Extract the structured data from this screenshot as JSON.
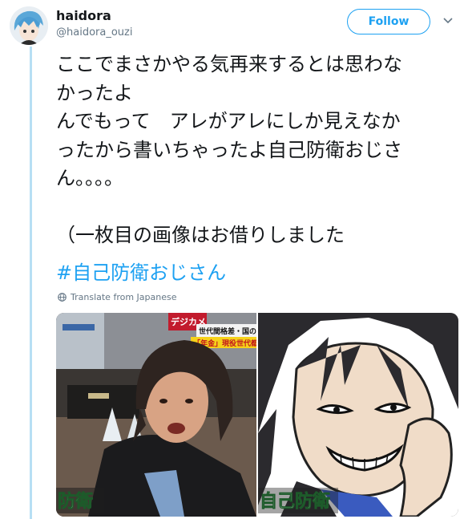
{
  "user": {
    "display_name": "haidora",
    "handle": "@haidora_ouzi"
  },
  "follow_label": "Follow",
  "tweet": {
    "lines": [
      "ここでまさかやる気再来するとは思わな",
      "かったよ",
      "んでもって　アレがアレにしか見えなか",
      "ったから書いちゃったよ自己防衛おじさ",
      "ん。。。。",
      "",
      "（一枚目の画像はお借りしました"
    ],
    "hashtag": "#自己防衛おじさん"
  },
  "translate_label": "Translate from Japanese",
  "media": {
    "left_image": {
      "sign_top": "デジカメ",
      "banner_line1": "世代間格差・国の借",
      "banner_line2": "「年金」現役世代都",
      "caption": "防衛"
    },
    "right_image": {
      "caption": "自己防衛"
    }
  },
  "colors": {
    "accent": "#1da1f2",
    "thread_line": "#b7dff4",
    "text": "#14171a",
    "muted": "#657786"
  }
}
